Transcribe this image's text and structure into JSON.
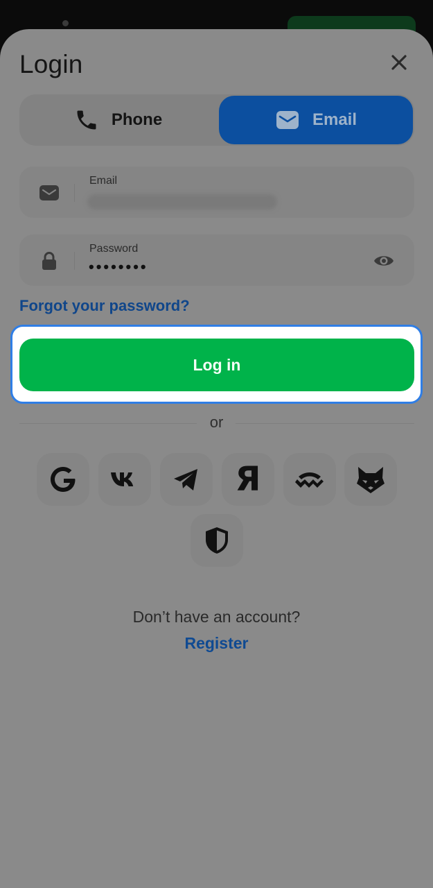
{
  "header": {
    "title": "Login"
  },
  "method_tabs": [
    {
      "label": "Phone",
      "icon": "phone-icon",
      "active": false
    },
    {
      "label": "Email",
      "icon": "mail-icon",
      "active": true
    }
  ],
  "form": {
    "email": {
      "label": "Email",
      "icon": "mail-icon",
      "value_obscured": true
    },
    "password": {
      "label": "Password",
      "icon": "lock-icon",
      "value": "••••••••",
      "toggle_icon": "eye-icon"
    },
    "forgot_label": "Forgot your password?",
    "submit_label": "Log in"
  },
  "divider_text": "or",
  "social_providers": [
    "google-icon",
    "vk-icon",
    "telegram-icon",
    "yandex-icon",
    "walletconnect-icon",
    "fox-icon",
    "shield-icon"
  ],
  "social_glyphs": {
    "yandex": "Я"
  },
  "footer": {
    "prompt": "Don’t have an account?",
    "register_label": "Register"
  },
  "colors": {
    "overlay": "#8a8a8a",
    "active_tab": "#0c4f9f",
    "submit": "#00b34a",
    "highlight_ring": "#2f7ee6",
    "link": "#10468a"
  }
}
